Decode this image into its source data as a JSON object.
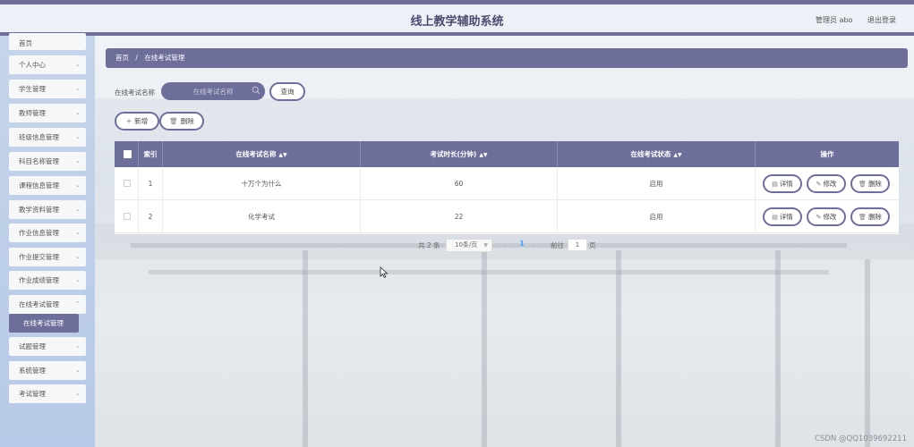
{
  "header": {
    "title": "线上教学辅助系统",
    "user": "管理员 abo",
    "logout": "退出登录"
  },
  "sidebar": {
    "items": [
      {
        "label": "首页"
      },
      {
        "label": "个人中心"
      },
      {
        "label": "学生管理"
      },
      {
        "label": "教师管理"
      },
      {
        "label": "班级信息管理"
      },
      {
        "label": "科目名称管理"
      },
      {
        "label": "课程信息管理"
      },
      {
        "label": "教学资料管理"
      },
      {
        "label": "作业信息管理"
      },
      {
        "label": "作业提交管理"
      },
      {
        "label": "作业成绩管理"
      },
      {
        "label": "在线考试管理"
      },
      {
        "label": "试题管理"
      },
      {
        "label": "系统管理"
      },
      {
        "label": "考试管理"
      }
    ],
    "submenu_active": "在线考试管理"
  },
  "breadcrumb": {
    "home": "首页",
    "separator": "/",
    "current": "在线考试管理"
  },
  "search": {
    "label": "在线考试名称",
    "placeholder": "在线考试名称",
    "button": "查询"
  },
  "actions": {
    "add": "新增",
    "delete": "删除"
  },
  "table": {
    "columns": [
      "索引",
      "在线考试名称",
      "考试时长(分钟)",
      "在线考试状态",
      "操作"
    ],
    "rows": [
      {
        "index": "1",
        "name": "十万个为什么",
        "duration": "60",
        "status": "启用"
      },
      {
        "index": "2",
        "name": "化学考试",
        "duration": "22",
        "status": "启用"
      }
    ],
    "row_actions": {
      "detail": "详情",
      "edit": "修改",
      "delete": "删除"
    }
  },
  "pagination": {
    "total": "共 2 条",
    "page_size": "10条/页",
    "current_page": "1",
    "goto_label": "前往",
    "goto_value": "1",
    "page_suffix": "页"
  },
  "watermark": "CSDN @QQ1039692211",
  "colors": {
    "accent": "#6d6e9a",
    "sidebar_bg": "#b7c9e6",
    "page_active": "#409eff"
  }
}
